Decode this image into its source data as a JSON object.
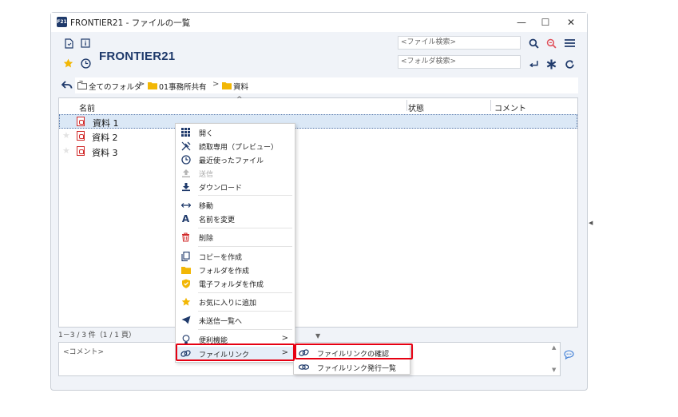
{
  "window": {
    "title": "FRONTIER21 - ファイルの一覧",
    "app_icon_text": "F21",
    "controls": {
      "minimize": "—",
      "maximize": "☐",
      "close": "✕"
    }
  },
  "header": {
    "brand": "FRONTIER21",
    "file_search_placeholder": "<ファイル検索>",
    "folder_search_placeholder": "<フォルダ検索>"
  },
  "breadcrumb": {
    "items": [
      "全てのフォルダ",
      "01事務所共有",
      "資料"
    ],
    "separator": ">"
  },
  "file_list": {
    "columns": {
      "name": "名前",
      "status": "状態",
      "comment": "コメント"
    },
    "sort_indicator": "^",
    "rows": [
      {
        "name": "資料 1",
        "selected": true
      },
      {
        "name": "資料 2",
        "selected": false
      },
      {
        "name": "資料 3",
        "selected": false
      }
    ]
  },
  "status_bar": {
    "text": "1－3 / 3 件（1 / 1 頁）"
  },
  "comment": {
    "placeholder": "<コメント>"
  },
  "context_menu": {
    "items": [
      {
        "label": "開く",
        "icon": "grid-icon",
        "disabled": false
      },
      {
        "label": "読取専用（プレビュー）",
        "icon": "readonly-icon",
        "disabled": false
      },
      {
        "label": "最近使ったファイル",
        "icon": "clock-icon",
        "disabled": false
      },
      {
        "label": "送信",
        "icon": "upload-icon",
        "disabled": true
      },
      {
        "label": "ダウンロード",
        "icon": "download-icon",
        "disabled": false
      },
      {
        "label": "移動",
        "icon": "move-icon",
        "disabled": false
      },
      {
        "label": "名前を変更",
        "icon": "rename-icon",
        "disabled": false
      },
      {
        "label": "削除",
        "icon": "trash-icon",
        "disabled": false
      },
      {
        "label": "コピーを作成",
        "icon": "copy-icon",
        "disabled": false
      },
      {
        "label": "フォルダを作成",
        "icon": "folder-icon",
        "disabled": false
      },
      {
        "label": "電子フォルダを作成",
        "icon": "shield-folder-icon",
        "disabled": false
      },
      {
        "label": "お気に入りに追加",
        "icon": "star-icon",
        "disabled": false
      },
      {
        "label": "未送信一覧へ",
        "icon": "send-icon",
        "disabled": false
      },
      {
        "label": "便利機能",
        "icon": "bulb-icon",
        "disabled": false,
        "submenu": true
      },
      {
        "label": "ファイルリンク",
        "icon": "link-icon",
        "disabled": false,
        "submenu": true
      }
    ],
    "submenu_arrow": ">"
  },
  "submenu": {
    "items": [
      {
        "label": "ファイルリンクの確認",
        "icon": "link-icon"
      },
      {
        "label": "ファイルリンク発行一覧",
        "icon": "link-list-icon"
      }
    ]
  },
  "colors": {
    "accent": "#1f3a6b",
    "highlight": "#e60012",
    "selection": "#dbe8f6",
    "folder": "#f2b705",
    "pdf": "#d12a2a",
    "delete": "#d12a2a"
  }
}
